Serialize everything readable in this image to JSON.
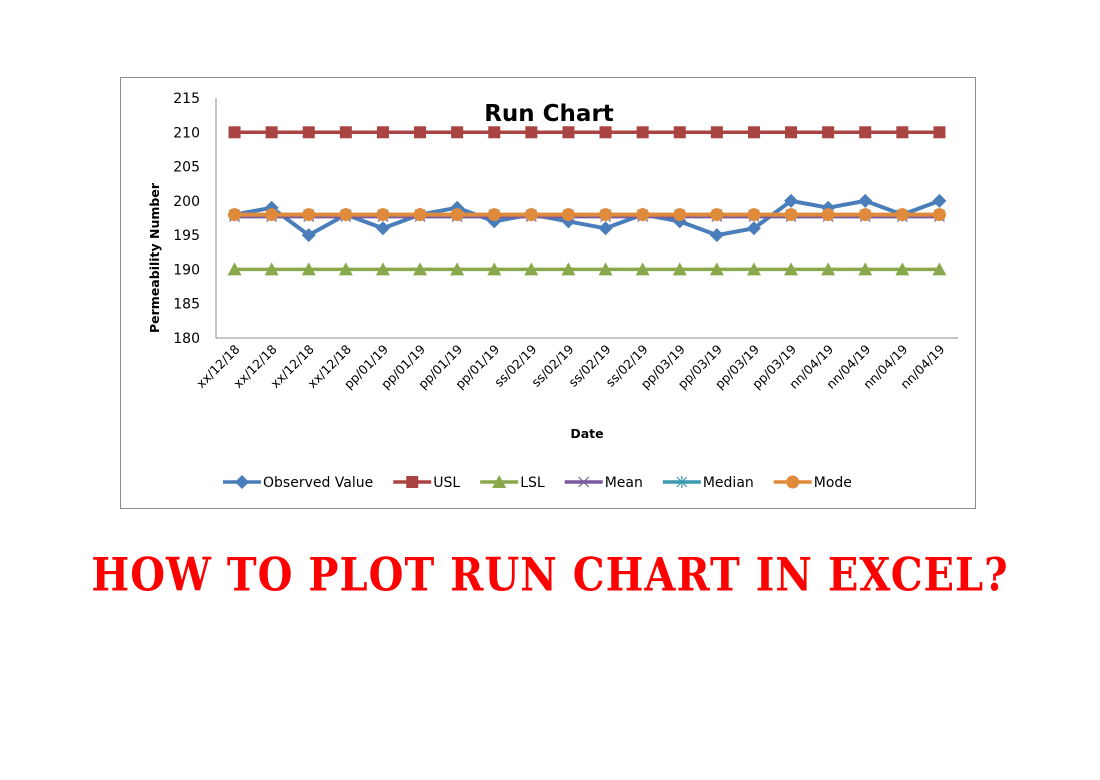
{
  "heading": "HOW TO PLOT RUN CHART IN EXCEL?",
  "colors": {
    "observed": "#4a7ebb",
    "usl": "#a94442",
    "lsl": "#88a84b",
    "mean": "#7a5a9e",
    "median": "#3a9ab0",
    "mode": "#e08a3c",
    "heading": "#ff0000",
    "axis": "#8c8c8c"
  },
  "chart_data": {
    "type": "line",
    "title": "Run Chart",
    "xlabel": "Date",
    "ylabel": "Permeability Number",
    "ylim": [
      180,
      215
    ],
    "yticks": [
      180,
      185,
      190,
      195,
      200,
      205,
      210,
      215
    ],
    "grid": false,
    "legend_position": "bottom",
    "categories": [
      "xx/12/18",
      "xx/12/18",
      "xx/12/18",
      "xx/12/18",
      "pp/01/19",
      "pp/01/19",
      "pp/01/19",
      "pp/01/19",
      "ss/02/19",
      "ss/02/19",
      "ss/02/19",
      "ss/02/19",
      "pp/03/19",
      "pp/03/19",
      "pp/03/19",
      "pp/03/19",
      "nn/04/19",
      "nn/04/19",
      "nn/04/19",
      "nn/04/19"
    ],
    "series": [
      {
        "name": "Observed Value",
        "marker": "diamond",
        "color_key": "observed",
        "values": [
          198,
          199,
          195,
          198,
          196,
          198,
          199,
          197,
          198,
          197,
          196,
          198,
          197,
          195,
          196,
          200,
          199,
          200,
          198,
          200
        ]
      },
      {
        "name": "USL",
        "marker": "square",
        "color_key": "usl",
        "values": [
          210,
          210,
          210,
          210,
          210,
          210,
          210,
          210,
          210,
          210,
          210,
          210,
          210,
          210,
          210,
          210,
          210,
          210,
          210,
          210
        ]
      },
      {
        "name": "LSL",
        "marker": "triangle",
        "color_key": "lsl",
        "values": [
          190,
          190,
          190,
          190,
          190,
          190,
          190,
          190,
          190,
          190,
          190,
          190,
          190,
          190,
          190,
          190,
          190,
          190,
          190,
          190
        ]
      },
      {
        "name": "Mean",
        "marker": "x",
        "color_key": "mean",
        "values": [
          197.7,
          197.7,
          197.7,
          197.7,
          197.7,
          197.7,
          197.7,
          197.7,
          197.7,
          197.7,
          197.7,
          197.7,
          197.7,
          197.7,
          197.7,
          197.7,
          197.7,
          197.7,
          197.7,
          197.7
        ]
      },
      {
        "name": "Median",
        "marker": "star",
        "color_key": "median",
        "values": [
          198,
          198,
          198,
          198,
          198,
          198,
          198,
          198,
          198,
          198,
          198,
          198,
          198,
          198,
          198,
          198,
          198,
          198,
          198,
          198
        ]
      },
      {
        "name": "Mode",
        "marker": "circle",
        "color_key": "mode",
        "values": [
          198,
          198,
          198,
          198,
          198,
          198,
          198,
          198,
          198,
          198,
          198,
          198,
          198,
          198,
          198,
          198,
          198,
          198,
          198,
          198
        ]
      }
    ]
  }
}
